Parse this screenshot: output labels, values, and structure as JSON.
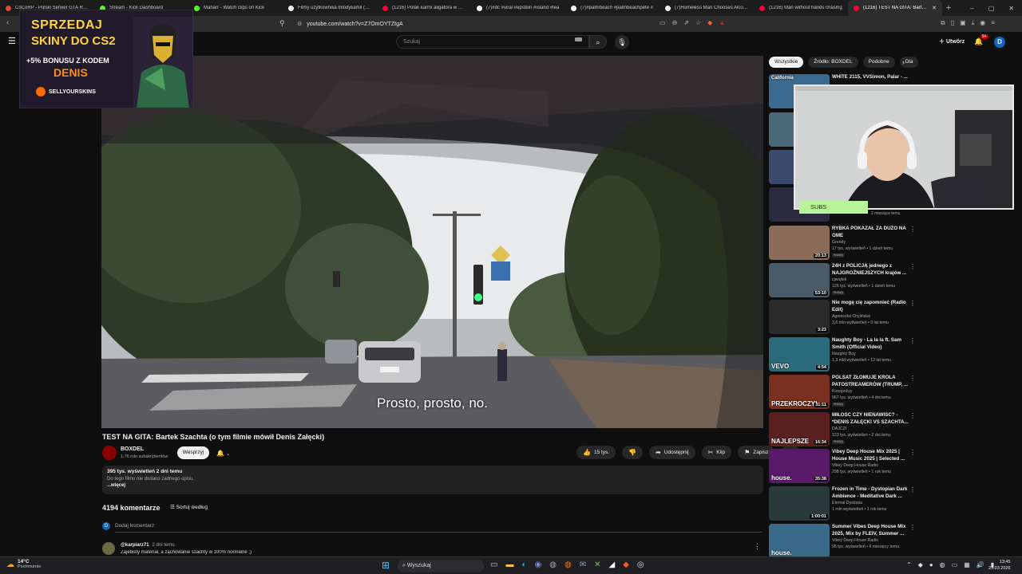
{
  "browser": {
    "tabs": [
      {
        "label": "CoCoRP - Polski Serwer GTA RP W",
        "color": "#e24a2c",
        "active": false
      },
      {
        "label": "Stream - Kick Dashboard",
        "color": "#53fc18",
        "active": false
      },
      {
        "label": "Maharr - Watch clips on Kick",
        "color": "#53fc18",
        "active": false
      },
      {
        "label": "Filmy użytkownika mlodykamil (@m",
        "color": "#ffffff",
        "active": false
      },
      {
        "label": "(1216) Polak karmi aligatora w USA",
        "color": "#ff0033",
        "active": false
      },
      {
        "label": "(7)#dc #viral #epstein #island #tea",
        "color": "#ffffff",
        "active": false
      },
      {
        "label": "(7)#palmbeach #palmbeachpete #",
        "color": "#ffffff",
        "active": false
      },
      {
        "label": "(7)Homeless Man Chooses Alcoho",
        "color": "#ffffff",
        "active": false
      },
      {
        "label": "(1216) Man without hands chasing",
        "color": "#ff0033",
        "active": false
      },
      {
        "label": "(1216) TEST NA GITA: Bartek Sz",
        "color": "#ff0033",
        "active": true
      }
    ],
    "new_tab": "+",
    "url": "youtube.com/watch?v=Z7OmOYTZtgA",
    "window_controls": [
      "–",
      "▢",
      "✕"
    ]
  },
  "yt_header": {
    "search_placeholder": "Szukaj",
    "create_label": "Utwórz",
    "notif_count": "9+",
    "avatar_letter": "D"
  },
  "ad": {
    "line1": "SPRZEDAJ",
    "line2": "SKINY DO CS2",
    "line3": "+5% BONUSU Z KODEM",
    "line4": "DENIS",
    "brand": "SELLYOURSKINS"
  },
  "video": {
    "subtitle": "Prosto, prosto, no.",
    "title": "TEST NA GITA: Bartek Szachta (o tym filmie mówił Denis Załęcki)",
    "channel": "BOXDEL",
    "subscribers": "1,76 mln subskrybentów",
    "support_label": "Wesprzyj",
    "likes": "15 tys.",
    "share_label": "Udostępnij",
    "clip_label": "Klip",
    "save_label": "Zapisz",
    "views_date": "395 tys. wyświetleń  2 dni temu",
    "description": "Do tego filmu nie dodano żadnego opisu.",
    "more_label": "...więcej",
    "comments_count": "4194 komentarze",
    "sort_label": "Sortuj według",
    "add_comment": "Dodaj komentarz",
    "my_avatar": "D",
    "first_comment": {
      "user": "@karpiarz71",
      "when": "2 dni temu",
      "text": "Zajebisty materiał, a zachowanie szachty w 100% normalne ;)"
    }
  },
  "sidebar": {
    "chips": [
      "Wszystkie",
      "Źródło: BOXDEL",
      "Podobne",
      "Dla"
    ],
    "top_item": {
      "title": "WHITE 2115, VVSimon, Palar - ...",
      "thumb_text": "California"
    },
    "hidden_meta": "2 miesiące temu",
    "recs": [
      {
        "title": "RYBKA POKAZAŁ ZA DUŻO NA OME",
        "channel": "Grendy",
        "meta": "17 tys. wyświetleń • 1 dzień temu",
        "badge": "Nowy",
        "duration": "20:13",
        "thumb": "#8a6b58",
        "thumb_text": ""
      },
      {
        "title": "24H z POLICJĄ jednego z NAJGROŹNIEJSZYCH krajów ...",
        "channel": "cjwojtek",
        "meta": "126 tys. wyświetleń • 1 dzień temu",
        "badge": "Nowy",
        "duration": "53:10",
        "thumb": "#4a5a66",
        "thumb_text": ""
      },
      {
        "title": "Nie mogę cię zapomnieć (Radio Edit)",
        "channel": "Agnieszka Chylińska",
        "meta": "3,6 mln wyświetleń • 9 lat temu",
        "badge": "",
        "duration": "3:23",
        "thumb": "#2b2b2b",
        "thumb_text": ""
      },
      {
        "title": "Naughty Boy - La la la ft. Sam Smith (Official Video)",
        "channel": "Naughty Boy",
        "meta": "1,3 mld wyświetleń • 12 lat temu",
        "badge": "",
        "duration": "4:54",
        "thumb": "#2a6a7a",
        "thumb_text": "VEVO"
      },
      {
        "title": "POLSAT ZŁOMUJE KRÓLA PATOSTREAMERÓW (TRUMP, ...",
        "channel": "Konopskyy",
        "meta": "967 tys. wyświetleń • 4 dni temu",
        "badge": "Nowy",
        "duration": "31:11",
        "thumb": "#7a3020",
        "thumb_text": "PRZEKROCZYŁ"
      },
      {
        "title": "MIŁOŚĆ CZY NIENAWIŚĆ? - *DENIS ZAŁĘCKI VS SZACHTA...",
        "channel": "DAJCZI",
        "meta": "123 tys. wyświetleń • 2 dni temu",
        "badge": "Nowy",
        "duration": "16:34",
        "thumb": "#5a2020",
        "thumb_text": "NAJLEPSZE"
      },
      {
        "title": "Vibey Deep House Mix 2025 | House Music 2025 | Selected ...",
        "channel": "Vibey Deep House Radio",
        "meta": "298 tys. wyświetleń • 1 rok temu",
        "badge": "",
        "duration": "35:38",
        "thumb": "#5a1a6a",
        "thumb_text": "house."
      },
      {
        "title": "Frozen in Time - Dystopian Dark Ambience - Meditative Dark ...",
        "channel": "Eternal Dystopia",
        "meta": "1 mln wyświetleń • 1 rok temu",
        "badge": "",
        "duration": "1:00:01",
        "thumb": "#2a3a3a",
        "thumb_text": ""
      },
      {
        "title": "Summer Vibes Deep House Mix 2025, Mix by FLEIV, Summer ...",
        "channel": "Vibey Deep House Radio",
        "meta": "95 tys. wyświetleń • 6 miesięcy temu",
        "badge": "",
        "duration": "",
        "thumb": "#3a6a8a",
        "thumb_text": "house."
      }
    ]
  },
  "webcam": {
    "label": "SUBS"
  },
  "taskbar": {
    "temp": "14°C",
    "condition": "Pochmurnie",
    "search_label": "Wyszukaj",
    "time": "13:45",
    "date": "23.03.2026"
  }
}
